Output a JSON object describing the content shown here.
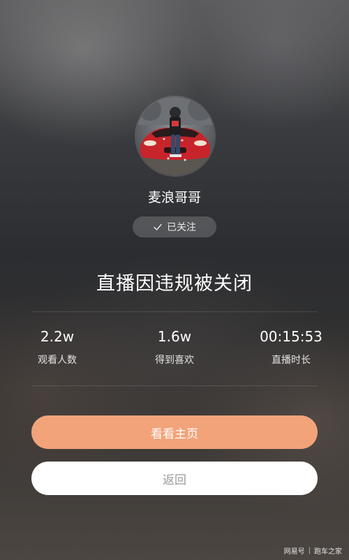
{
  "streamer": {
    "name": "麦浪哥哥",
    "avatar_icon": "avatar-photo-red-car"
  },
  "follow": {
    "label": "已关注",
    "icon": "check-icon"
  },
  "status": {
    "title": "直播因违规被关闭"
  },
  "stats": [
    {
      "value": "2.2w",
      "label": "观看人数"
    },
    {
      "value": "1.6w",
      "label": "得到喜欢"
    },
    {
      "value": "00:15:53",
      "label": "直播时长"
    }
  ],
  "actions": {
    "primary_label": "看看主页",
    "secondary_label": "返回"
  },
  "colors": {
    "primary_button": "#f2a37a",
    "secondary_button": "#ffffff"
  },
  "watermark": {
    "source": "网易号",
    "author": "跑车之家"
  }
}
